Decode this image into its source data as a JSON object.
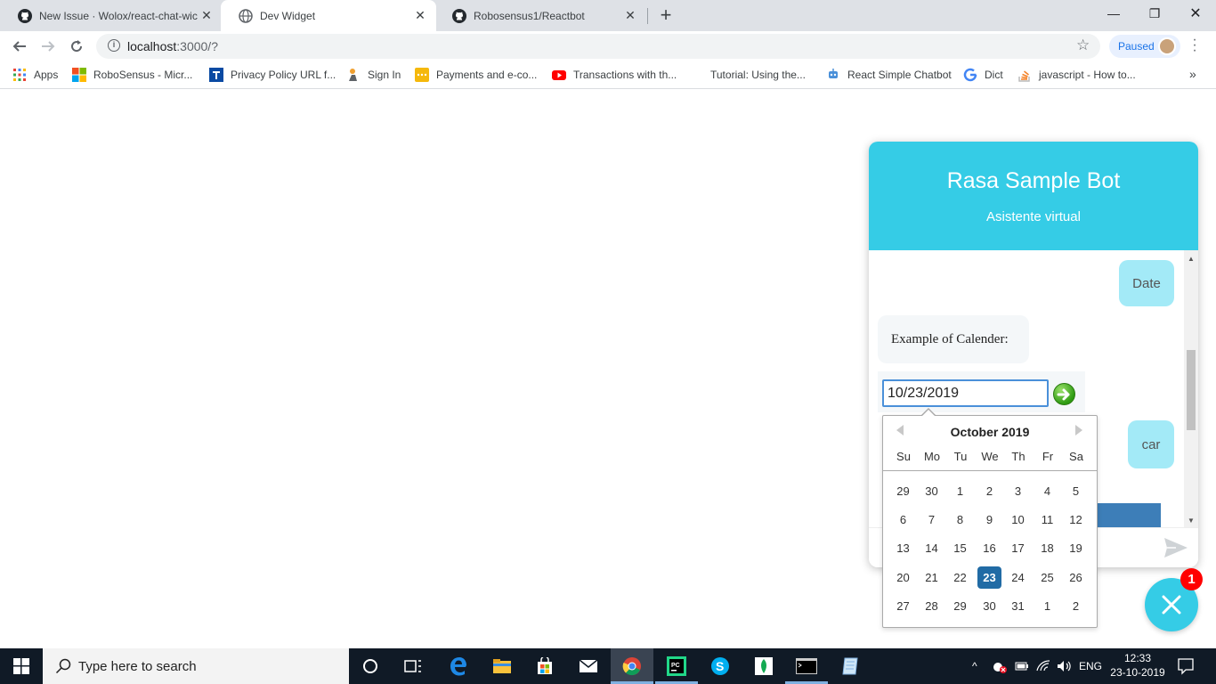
{
  "browser": {
    "tabs": [
      {
        "title": "New Issue · Wolox/react-chat-wic",
        "icon": "github-icon",
        "active": false
      },
      {
        "title": "Dev Widget",
        "icon": "globe-icon",
        "active": true
      },
      {
        "title": "Robosensus1/Reactbot",
        "icon": "github-icon",
        "active": false
      }
    ],
    "tab_close_glyph": "✕",
    "new_tab_glyph": "+",
    "window": {
      "minimize": "—",
      "restore": "❐",
      "close": "✕"
    },
    "url_host": "localhost",
    "url_rest": ":3000/?",
    "profile_status": "Paused",
    "bookmarks": [
      {
        "label": "Apps",
        "icon": "apps-grid-icon"
      },
      {
        "label": "RoboSensus - Micr...",
        "icon": "microsoft-icon"
      },
      {
        "label": "Privacy Policy URL f...",
        "icon": "t-logo-icon"
      },
      {
        "label": "Sign In",
        "icon": "signin-icon"
      },
      {
        "label": "Payments and e-co...",
        "icon": "payments-icon"
      },
      {
        "label": "Transactions with th...",
        "icon": "youtube-icon"
      },
      {
        "label": "Tutorial: Using the...",
        "icon": "blank-icon"
      },
      {
        "label": "React Simple Chatbot",
        "icon": "react-bot-icon"
      },
      {
        "label": "Dict",
        "icon": "google-icon"
      },
      {
        "label": "javascript - How to...",
        "icon": "stackoverflow-icon"
      }
    ],
    "bookmarks_more": "»"
  },
  "widget": {
    "title": "Rasa Sample Bot",
    "subtitle": "Asistente virtual",
    "messages": {
      "user_date": "Date",
      "bot_calendar": "Example of Calender:",
      "user_car": "car"
    },
    "date_value": "10/23/2019",
    "unread_count": "1"
  },
  "datepicker": {
    "month_label": "October 2019",
    "weekdays": [
      "Su",
      "Mo",
      "Tu",
      "We",
      "Th",
      "Fr",
      "Sa"
    ],
    "weeks": [
      [
        "29",
        "30",
        "1",
        "2",
        "3",
        "4",
        "5"
      ],
      [
        "6",
        "7",
        "8",
        "9",
        "10",
        "11",
        "12"
      ],
      [
        "13",
        "14",
        "15",
        "16",
        "17",
        "18",
        "19"
      ],
      [
        "20",
        "21",
        "22",
        "23",
        "24",
        "25",
        "26"
      ],
      [
        "27",
        "28",
        "29",
        "30",
        "31",
        "1",
        "2"
      ]
    ],
    "selected": "23",
    "selected_color": "#216ba5"
  },
  "taskbar": {
    "search_placeholder": "Type here to search",
    "language": "ENG",
    "time": "12:33",
    "date": "23-10-2019"
  },
  "colors": {
    "widget_accent": "#35cce6",
    "user_bubble": "#a3eaf7",
    "badge": "#ff0000"
  }
}
